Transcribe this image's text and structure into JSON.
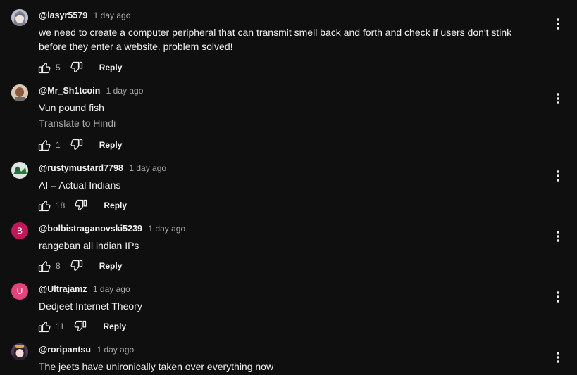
{
  "comments": [
    {
      "author": "@lasyr5579",
      "time": "1 day ago",
      "text": "we need to create a computer peripheral that can transmit smell back and forth and check if users don't stink before they enter a website. problem solved!",
      "likes": "5",
      "reply_label": "Reply",
      "avatar_icon": "anime-avatar-icon"
    },
    {
      "author": "@Mr_Sh1tcoin",
      "time": "1 day ago",
      "text": "Vun pound fish",
      "translate_label": "Translate to Hindi",
      "likes": "1",
      "reply_label": "Reply",
      "avatar_icon": "photo-avatar-icon"
    },
    {
      "author": "@rustymustard7798",
      "time": "1 day ago",
      "text": "AI = Actual Indians",
      "likes": "18",
      "reply_label": "Reply",
      "avatar_icon": "green-avatar-icon"
    },
    {
      "author": "@bolbistraganovski5239",
      "time": "1 day ago",
      "text": "rangeban all indian IPs",
      "likes": "8",
      "reply_label": "Reply",
      "avatar_letter": "B",
      "avatar_color": "#c2185b"
    },
    {
      "author": "@Ultrajamz",
      "time": "1 day ago",
      "text": "Dedjeet Internet Theory",
      "likes": "11",
      "reply_label": "Reply",
      "avatar_letter": "U",
      "avatar_color": "#e0457b"
    },
    {
      "author": "@roripantsu",
      "time": "1 day ago",
      "text": "The jeets have unironically taken over everything now",
      "avatar_icon": "anime-avatar-icon"
    }
  ]
}
